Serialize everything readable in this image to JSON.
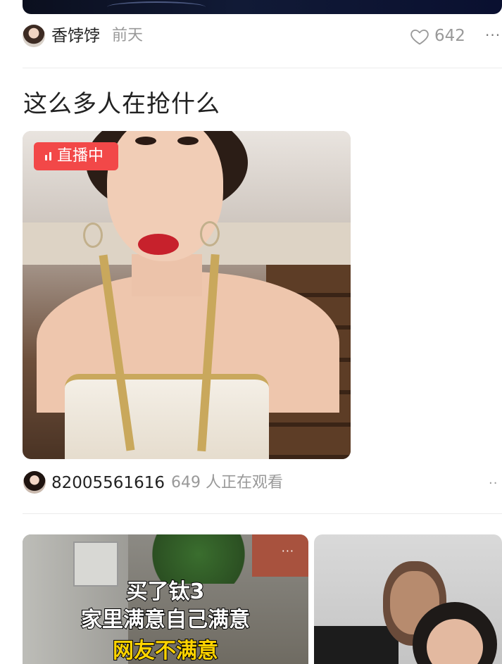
{
  "colors": {
    "live_badge_bg": "#f24848",
    "muted_text": "#999999",
    "primary_text": "#222222",
    "caption_highlight": "#ffd400"
  },
  "post1": {
    "author": "香饽饽",
    "time": "前天",
    "like_icon": "heart-outline-icon",
    "likes": "642",
    "more_icon": "ellipsis-icon",
    "more_symbol": "···"
  },
  "post2": {
    "title": "这么多人在抢什么",
    "live_badge": "直播中",
    "streamer": "82005561616",
    "viewers": "649 人正在观看",
    "more_symbol": "··"
  },
  "feed": {
    "left_card": {
      "more_symbol": "···",
      "caption_lines": [
        "买了钛3",
        "家里满意自己满意",
        "网友不满意"
      ]
    }
  }
}
